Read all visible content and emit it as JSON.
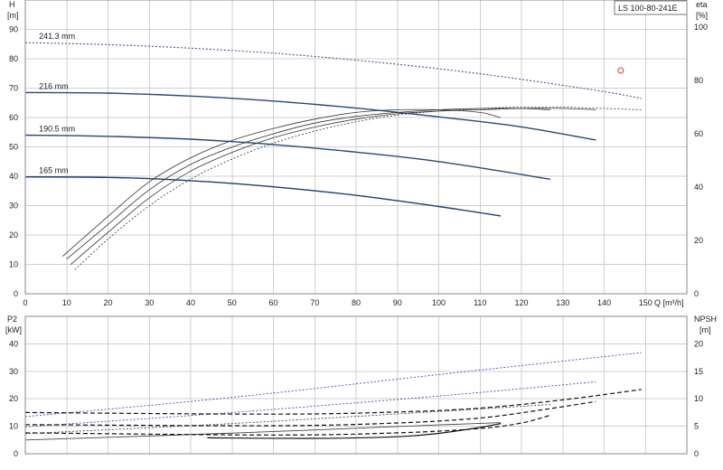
{
  "chart_data": [
    {
      "type": "line",
      "panel": "performance",
      "model": "LS 100-80-241E",
      "ylabel": "H",
      "yunit": "[m]",
      "y2label": "eta",
      "y2unit": "[%]",
      "xlabel": "Q [m³/h]",
      "xlim": [
        0,
        160
      ],
      "ylim": [
        0,
        100
      ],
      "y2lim": [
        0,
        100
      ],
      "x_ticks": [
        0,
        10,
        20,
        30,
        40,
        50,
        60,
        70,
        80,
        90,
        100,
        110,
        120,
        130,
        140,
        150
      ],
      "y_ticks": [
        0,
        10,
        20,
        30,
        40,
        50,
        60,
        70,
        80,
        90
      ],
      "y2_ticks": [
        0,
        20,
        40,
        60,
        80,
        100
      ],
      "grid": true,
      "head_curves": [
        {
          "name": "241.3 mm",
          "color": "#3d5a8a",
          "style": "dotted",
          "x": [
            0,
            20,
            40,
            60,
            80,
            100,
            120,
            140,
            149
          ],
          "y": [
            85.5,
            84.8,
            83.6,
            81.9,
            79.5,
            76.6,
            73.0,
            68.8,
            66.5
          ]
        },
        {
          "name": "216 mm",
          "color": "#1f4a80",
          "style": "solid",
          "x": [
            0,
            20,
            40,
            60,
            80,
            100,
            120,
            138
          ],
          "y": [
            68.5,
            68.3,
            67.3,
            65.6,
            63.2,
            60.2,
            56.8,
            52.3
          ]
        },
        {
          "name": "190.5 mm",
          "color": "#1f4a80",
          "style": "solid",
          "x": [
            0,
            20,
            40,
            60,
            80,
            100,
            127
          ],
          "y": [
            54.0,
            53.6,
            52.6,
            50.8,
            48.2,
            45.0,
            39.0
          ]
        },
        {
          "name": "165 mm",
          "color": "#1a3f70",
          "style": "solid",
          "x": [
            0,
            20,
            40,
            60,
            80,
            100,
            115
          ],
          "y": [
            39.8,
            39.6,
            38.5,
            36.4,
            33.5,
            29.7,
            26.5
          ]
        }
      ],
      "efficiency_curves": [
        {
          "style": "dotted",
          "x": [
            12,
            20,
            30,
            40,
            50,
            60,
            70,
            80,
            90,
            100,
            110,
            120,
            130,
            140,
            149
          ],
          "y": [
            9,
            20.5,
            33,
            43,
            50.5,
            56.5,
            61,
            64.5,
            67,
            68.5,
            69.5,
            70,
            70,
            69.5,
            69
          ]
        },
        {
          "style": "solid",
          "x": [
            11,
            20,
            30,
            40,
            50,
            60,
            70,
            80,
            90,
            100,
            110,
            120,
            130,
            138
          ],
          "y": [
            11,
            23,
            36,
            46,
            53,
            58.5,
            62.5,
            65.5,
            67.5,
            68.5,
            69,
            69.5,
            69.5,
            69
          ]
        },
        {
          "style": "solid",
          "x": [
            10,
            20,
            30,
            40,
            50,
            60,
            70,
            80,
            90,
            100,
            110,
            120,
            127
          ],
          "y": [
            13,
            26,
            39,
            48.5,
            55,
            60,
            64,
            66.5,
            68,
            69,
            69.5,
            69.5,
            69
          ]
        },
        {
          "style": "solid",
          "x": [
            9,
            20,
            30,
            40,
            50,
            60,
            70,
            80,
            90,
            100,
            110,
            115
          ],
          "y": [
            14,
            29,
            42,
            51,
            57.5,
            62,
            65.5,
            68,
            69,
            69,
            68,
            66
          ]
        }
      ],
      "annotations": [
        "241.3 mm",
        "216 mm",
        "190.5 mm",
        "165 mm"
      ],
      "duty_point": {
        "x": 144,
        "y": 76,
        "color": "#e0402a"
      }
    },
    {
      "type": "line",
      "panel": "power_npsh",
      "ylabel": "P2",
      "yunit": "[kW]",
      "y2label": "NPSH",
      "y2unit": "[m]",
      "xlim": [
        0,
        160
      ],
      "ylim": [
        0,
        50
      ],
      "y2lim": [
        0,
        25
      ],
      "y_ticks": [
        0,
        10,
        20,
        30,
        40
      ],
      "y2_ticks": [
        0,
        5,
        10,
        15,
        20
      ],
      "grid": true,
      "power_curves": [
        {
          "name": "241.3 mm",
          "color": "#3a54a8",
          "style": "dotted",
          "x": [
            0,
            50,
            100,
            149
          ],
          "y": [
            13.5,
            20.5,
            28.8,
            36.8
          ]
        },
        {
          "name": "216 mm",
          "color": "#3a54a8",
          "style": "dotted",
          "x": [
            0,
            50,
            100,
            138
          ],
          "y": [
            9.8,
            15,
            21,
            26.2
          ]
        },
        {
          "name": "190.5 mm",
          "color": "#444",
          "style": "dotted",
          "x": [
            0,
            50,
            100,
            127
          ],
          "y": [
            7.3,
            11,
            15.4,
            17.9
          ]
        },
        {
          "name": "165 mm",
          "color": "#444",
          "style": "solid",
          "x": [
            0,
            50,
            100,
            115
          ],
          "y": [
            5,
            7.5,
            10.5,
            11.3
          ]
        }
      ],
      "npsh_curves": [
        {
          "x": [
            0,
            60,
            90,
            110,
            130,
            149
          ],
          "y": [
            7.5,
            7.2,
            7.6,
            8.3,
            9.8,
            11.7
          ]
        },
        {
          "x": [
            0,
            60,
            90,
            110,
            125,
            138
          ],
          "y": [
            5.3,
            5.1,
            5.6,
            6.5,
            8.0,
            9.5
          ]
        },
        {
          "x": [
            0,
            60,
            90,
            110,
            120,
            127
          ],
          "y": [
            3.8,
            3.4,
            3.8,
            4.6,
            5.6,
            7.0
          ]
        },
        {
          "x": [
            44,
            70,
            90,
            100,
            110,
            115
          ],
          "y": [
            2.9,
            2.8,
            3.1,
            3.7,
            4.8,
            5.5
          ]
        }
      ]
    }
  ]
}
